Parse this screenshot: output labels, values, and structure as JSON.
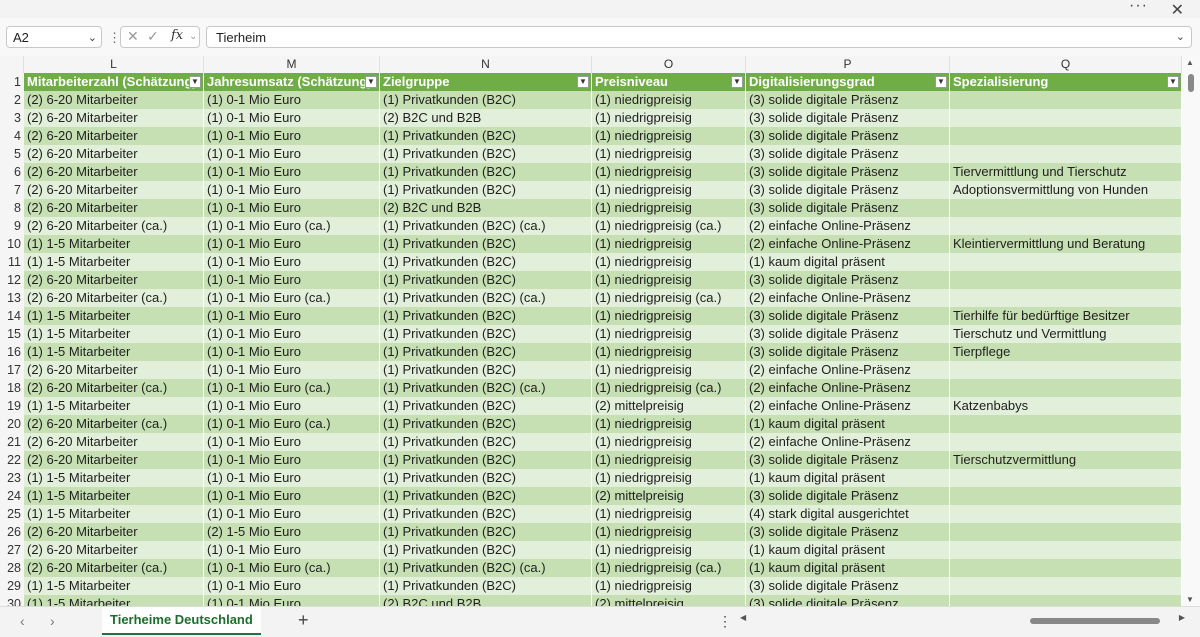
{
  "window": {
    "more_icon": "more-icon",
    "close_icon": "close-icon"
  },
  "formula_bar": {
    "name_box": "A2",
    "formula_value": "Tierheim",
    "fx_label": "fx"
  },
  "columns": [
    {
      "letter": "L",
      "header": "Mitarbeiterzahl (Schätzung)"
    },
    {
      "letter": "M",
      "header": "Jahresumsatz (Schätzung)"
    },
    {
      "letter": "N",
      "header": "Zielgruppe"
    },
    {
      "letter": "O",
      "header": "Preisniveau"
    },
    {
      "letter": "P",
      "header": "Digitalisierungsgrad"
    },
    {
      "letter": "Q",
      "header": "Spezialisierung"
    }
  ],
  "rows": [
    {
      "n": "2",
      "c": [
        "(2) 6-20 Mitarbeiter",
        "(1) 0-1 Mio Euro",
        "(1) Privatkunden (B2C)",
        "(1) niedrigpreisig",
        "(3) solide digitale Präsenz",
        ""
      ]
    },
    {
      "n": "3",
      "c": [
        "(2) 6-20 Mitarbeiter",
        "(1) 0-1 Mio Euro",
        "(2) B2C und B2B",
        "(1) niedrigpreisig",
        "(3) solide digitale Präsenz",
        ""
      ]
    },
    {
      "n": "4",
      "c": [
        "(2) 6-20 Mitarbeiter",
        "(1) 0-1 Mio Euro",
        "(1) Privatkunden (B2C)",
        "(1) niedrigpreisig",
        "(3) solide digitale Präsenz",
        ""
      ]
    },
    {
      "n": "5",
      "c": [
        "(2) 6-20 Mitarbeiter",
        "(1) 0-1 Mio Euro",
        "(1) Privatkunden (B2C)",
        "(1) niedrigpreisig",
        "(3) solide digitale Präsenz",
        ""
      ]
    },
    {
      "n": "6",
      "c": [
        "(2) 6-20 Mitarbeiter",
        "(1) 0-1 Mio Euro",
        "(1) Privatkunden (B2C)",
        "(1) niedrigpreisig",
        "(3) solide digitale Präsenz",
        "Tiervermittlung und Tierschutz"
      ]
    },
    {
      "n": "7",
      "c": [
        "(2) 6-20 Mitarbeiter",
        "(1) 0-1 Mio Euro",
        "(1) Privatkunden (B2C)",
        "(1) niedrigpreisig",
        "(3) solide digitale Präsenz",
        "Adoptionsvermittlung von Hunden"
      ]
    },
    {
      "n": "8",
      "c": [
        "(2) 6-20 Mitarbeiter",
        "(1) 0-1 Mio Euro",
        "(2) B2C und B2B",
        "(1) niedrigpreisig",
        "(3) solide digitale Präsenz",
        ""
      ]
    },
    {
      "n": "9",
      "c": [
        "(2) 6-20 Mitarbeiter (ca.)",
        "(1) 0-1 Mio Euro (ca.)",
        "(1) Privatkunden (B2C) (ca.)",
        "(1) niedrigpreisig (ca.)",
        "(2) einfache Online-Präsenz",
        ""
      ]
    },
    {
      "n": "10",
      "c": [
        "(1) 1-5 Mitarbeiter",
        "(1) 0-1 Mio Euro",
        "(1) Privatkunden (B2C)",
        "(1) niedrigpreisig",
        "(2) einfache Online-Präsenz",
        "Kleintiervermittlung und Beratung"
      ]
    },
    {
      "n": "11",
      "c": [
        "(1) 1-5 Mitarbeiter",
        "(1) 0-1 Mio Euro",
        "(1) Privatkunden (B2C)",
        "(1) niedrigpreisig",
        "(1) kaum digital präsent",
        ""
      ]
    },
    {
      "n": "12",
      "c": [
        "(2) 6-20 Mitarbeiter",
        "(1) 0-1 Mio Euro",
        "(1) Privatkunden (B2C)",
        "(1) niedrigpreisig",
        "(3) solide digitale Präsenz",
        ""
      ]
    },
    {
      "n": "13",
      "c": [
        "(2) 6-20 Mitarbeiter (ca.)",
        "(1) 0-1 Mio Euro (ca.)",
        "(1) Privatkunden (B2C) (ca.)",
        "(1) niedrigpreisig (ca.)",
        "(2) einfache Online-Präsenz",
        ""
      ]
    },
    {
      "n": "14",
      "c": [
        "(1) 1-5 Mitarbeiter",
        "(1) 0-1 Mio Euro",
        "(1) Privatkunden (B2C)",
        "(1) niedrigpreisig",
        "(3) solide digitale Präsenz",
        "Tierhilfe für bedürftige Besitzer"
      ]
    },
    {
      "n": "15",
      "c": [
        "(1) 1-5 Mitarbeiter",
        "(1) 0-1 Mio Euro",
        "(1) Privatkunden (B2C)",
        "(1) niedrigpreisig",
        "(3) solide digitale Präsenz",
        "Tierschutz und Vermittlung"
      ]
    },
    {
      "n": "16",
      "c": [
        "(1) 1-5 Mitarbeiter",
        "(1) 0-1 Mio Euro",
        "(1) Privatkunden (B2C)",
        "(1) niedrigpreisig",
        "(3) solide digitale Präsenz",
        "Tierpflege"
      ]
    },
    {
      "n": "17",
      "c": [
        "(2) 6-20 Mitarbeiter",
        "(1) 0-1 Mio Euro",
        "(1) Privatkunden (B2C)",
        "(1) niedrigpreisig",
        "(2) einfache Online-Präsenz",
        ""
      ]
    },
    {
      "n": "18",
      "c": [
        "(2) 6-20 Mitarbeiter (ca.)",
        "(1) 0-1 Mio Euro (ca.)",
        "(1) Privatkunden (B2C) (ca.)",
        "(1) niedrigpreisig (ca.)",
        "(2) einfache Online-Präsenz",
        ""
      ]
    },
    {
      "n": "19",
      "c": [
        "(1) 1-5 Mitarbeiter",
        "(1) 0-1 Mio Euro",
        "(1) Privatkunden (B2C)",
        "(2) mittelpreisig",
        "(2) einfache Online-Präsenz",
        "Katzenbabys"
      ]
    },
    {
      "n": "20",
      "c": [
        "(2) 6-20 Mitarbeiter (ca.)",
        "(1) 0-1 Mio Euro (ca.)",
        "(1) Privatkunden (B2C)",
        "(1) niedrigpreisig",
        "(1) kaum digital präsent",
        ""
      ]
    },
    {
      "n": "21",
      "c": [
        "(2) 6-20 Mitarbeiter",
        "(1) 0-1 Mio Euro",
        "(1) Privatkunden (B2C)",
        "(1) niedrigpreisig",
        "(2) einfache Online-Präsenz",
        ""
      ]
    },
    {
      "n": "22",
      "c": [
        "(2) 6-20 Mitarbeiter",
        "(1) 0-1 Mio Euro",
        "(1) Privatkunden (B2C)",
        "(1) niedrigpreisig",
        "(3) solide digitale Präsenz",
        "Tierschutzvermittlung"
      ]
    },
    {
      "n": "23",
      "c": [
        "(1) 1-5 Mitarbeiter",
        "(1) 0-1 Mio Euro",
        "(1) Privatkunden (B2C)",
        "(1) niedrigpreisig",
        "(1) kaum digital präsent",
        ""
      ]
    },
    {
      "n": "24",
      "c": [
        "(1) 1-5 Mitarbeiter",
        "(1) 0-1 Mio Euro",
        "(1) Privatkunden (B2C)",
        "(2) mittelpreisig",
        "(3) solide digitale Präsenz",
        ""
      ]
    },
    {
      "n": "25",
      "c": [
        "(1) 1-5 Mitarbeiter",
        "(1) 0-1 Mio Euro",
        "(1) Privatkunden (B2C)",
        "(1) niedrigpreisig",
        "(4) stark digital ausgerichtet",
        ""
      ]
    },
    {
      "n": "26",
      "c": [
        "(2) 6-20 Mitarbeiter",
        "(2) 1-5 Mio Euro",
        "(1) Privatkunden (B2C)",
        "(1) niedrigpreisig",
        "(3) solide digitale Präsenz",
        ""
      ]
    },
    {
      "n": "27",
      "c": [
        "(2) 6-20 Mitarbeiter",
        "(1) 0-1 Mio Euro",
        "(1) Privatkunden (B2C)",
        "(1) niedrigpreisig",
        "(1) kaum digital präsent",
        ""
      ]
    },
    {
      "n": "28",
      "c": [
        "(2) 6-20 Mitarbeiter (ca.)",
        "(1) 0-1 Mio Euro (ca.)",
        "(1) Privatkunden (B2C) (ca.)",
        "(1) niedrigpreisig (ca.)",
        "(1) kaum digital präsent",
        ""
      ]
    },
    {
      "n": "29",
      "c": [
        "(1) 1-5 Mitarbeiter",
        "(1) 0-1 Mio Euro",
        "(1) Privatkunden (B2C)",
        "(1) niedrigpreisig",
        "(3) solide digitale Präsenz",
        ""
      ]
    },
    {
      "n": "30",
      "c": [
        "(1) 1-5 Mitarbeiter",
        "(1) 0-1 Mio Euro",
        "(2) B2C und B2B",
        "(2) mittelpreisig",
        "(3) solide digitale Präsenz",
        ""
      ]
    }
  ],
  "sheet_tabs": [
    {
      "label": "Tierheime Deutschland"
    }
  ],
  "colors": {
    "header_green": "#70ad47",
    "band_dark": "#c6e0b4",
    "band_light": "#e2efda"
  }
}
